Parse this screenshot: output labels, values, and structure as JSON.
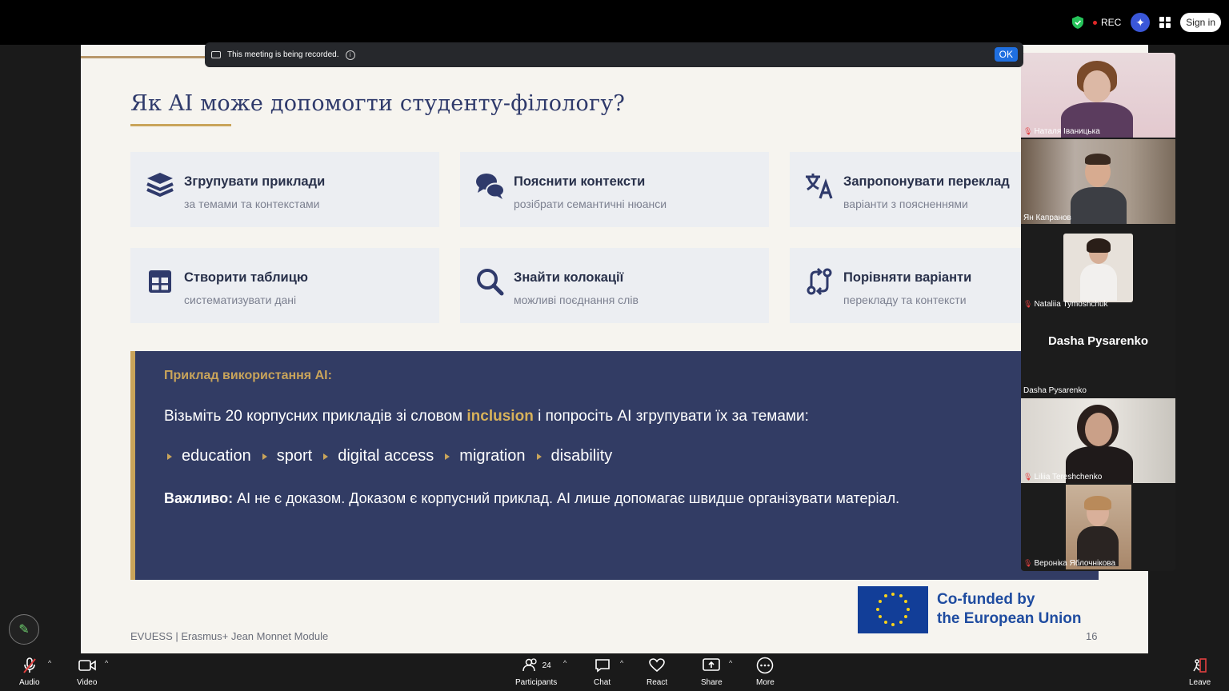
{
  "topbar": {
    "rec_label": "REC",
    "signin_label": "Sign in",
    "colors": {
      "shield": "#26c35a",
      "rec_dot": "#e02828",
      "ai": "#3a57d8"
    }
  },
  "recording_banner": {
    "text": "This meeting is being recorded.",
    "ok_label": "OK"
  },
  "slide": {
    "title": "Як AI може допомогти студенту-філологу?",
    "cards": [
      {
        "title": "Згрупувати приклади",
        "subtitle": "за темами та контекстами",
        "icon": "layers-icon"
      },
      {
        "title": "Пояснити контексти",
        "subtitle": "розібрати семантичні нюанси",
        "icon": "chat-bubbles-icon"
      },
      {
        "title": "Запропонувати переклад",
        "subtitle": "варіанти з поясненнями",
        "icon": "translate-icon"
      },
      {
        "title": "Створити таблицю",
        "subtitle": "систематизувати дані",
        "icon": "table-icon"
      },
      {
        "title": "Знайти колокації",
        "subtitle": "можливі поєднання слів",
        "icon": "search-icon"
      },
      {
        "title": "Порівняти варіанти",
        "subtitle": "перекладу та контексти",
        "icon": "compare-arrows-icon"
      }
    ],
    "example": {
      "heading": "Приклад використання AI:",
      "line_before": "Візьміть 20 корпусних прикладів зі словом ",
      "highlight": "inclusion",
      "line_after": " і попросіть AI згрупувати їх за темами:",
      "tags": [
        "education",
        "sport",
        "digital access",
        "migration",
        "disability"
      ],
      "note_bold": "Важливо:",
      "note_rest": " AI не є доказом. Доказом є корпусний приклад. AI лише допомагає швидше організувати матеріал."
    },
    "eu": {
      "line1": "Co-funded by",
      "line2": "the European Union"
    },
    "footer": "EVUESS | Erasmus+ Jean Monnet Module",
    "page": "16",
    "colors": {
      "title": "#2f3a6b",
      "gold": "#c9a45a",
      "panel": "#323c64"
    }
  },
  "gallery": [
    {
      "name": "Наталя Іваницька",
      "muted": true
    },
    {
      "name": "Ян Капранов",
      "muted": false,
      "active": true
    },
    {
      "name": "Nataliia Tymoshchuk",
      "muted": true
    },
    {
      "name": "Dasha Pysarenko",
      "muted": false,
      "video_off": true
    },
    {
      "name": "Liliia Tereshchenko",
      "muted": true
    },
    {
      "name": "Вероніка Яблочнікова",
      "muted": true
    }
  ],
  "toolbar": {
    "audio": "Audio",
    "video": "Video",
    "participants": "Participants",
    "participants_count": "24",
    "chat": "Chat",
    "react": "React",
    "share": "Share",
    "more": "More",
    "leave": "Leave"
  }
}
